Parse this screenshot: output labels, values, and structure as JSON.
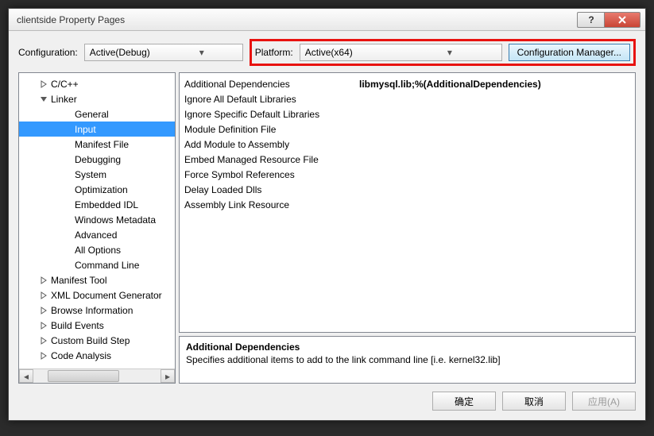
{
  "window": {
    "title": "clientside Property Pages"
  },
  "top": {
    "config_label": "Configuration:",
    "config_value": "Active(Debug)",
    "platform_label": "Platform:",
    "platform_value": "Active(x64)",
    "cfgmgr_label": "Configuration Manager..."
  },
  "tree": {
    "items": [
      {
        "depth": 1,
        "expander": "right",
        "label": "C/C++"
      },
      {
        "depth": 1,
        "expander": "down",
        "label": "Linker"
      },
      {
        "depth": 2,
        "expander": "",
        "label": "General"
      },
      {
        "depth": 2,
        "expander": "",
        "label": "Input",
        "selected": true
      },
      {
        "depth": 2,
        "expander": "",
        "label": "Manifest File"
      },
      {
        "depth": 2,
        "expander": "",
        "label": "Debugging"
      },
      {
        "depth": 2,
        "expander": "",
        "label": "System"
      },
      {
        "depth": 2,
        "expander": "",
        "label": "Optimization"
      },
      {
        "depth": 2,
        "expander": "",
        "label": "Embedded IDL"
      },
      {
        "depth": 2,
        "expander": "",
        "label": "Windows Metadata"
      },
      {
        "depth": 2,
        "expander": "",
        "label": "Advanced"
      },
      {
        "depth": 2,
        "expander": "",
        "label": "All Options"
      },
      {
        "depth": 2,
        "expander": "",
        "label": "Command Line"
      },
      {
        "depth": 1,
        "expander": "right",
        "label": "Manifest Tool"
      },
      {
        "depth": 1,
        "expander": "right",
        "label": "XML Document Generator"
      },
      {
        "depth": 1,
        "expander": "right",
        "label": "Browse Information"
      },
      {
        "depth": 1,
        "expander": "right",
        "label": "Build Events"
      },
      {
        "depth": 1,
        "expander": "right",
        "label": "Custom Build Step"
      },
      {
        "depth": 1,
        "expander": "right",
        "label": "Code Analysis"
      }
    ]
  },
  "grid": {
    "rows": [
      {
        "key": "Additional Dependencies",
        "value": "libmysql.lib;%(AdditionalDependencies)"
      },
      {
        "key": "Ignore All Default Libraries",
        "value": ""
      },
      {
        "key": "Ignore Specific Default Libraries",
        "value": ""
      },
      {
        "key": "Module Definition File",
        "value": ""
      },
      {
        "key": "Add Module to Assembly",
        "value": ""
      },
      {
        "key": "Embed Managed Resource File",
        "value": ""
      },
      {
        "key": "Force Symbol References",
        "value": ""
      },
      {
        "key": "Delay Loaded Dlls",
        "value": ""
      },
      {
        "key": "Assembly Link Resource",
        "value": ""
      }
    ]
  },
  "desc": {
    "title": "Additional Dependencies",
    "text": "Specifies additional items to add to the link command line [i.e. kernel32.lib]"
  },
  "buttons": {
    "ok": "确定",
    "cancel": "取消",
    "apply": "应用(A)"
  }
}
